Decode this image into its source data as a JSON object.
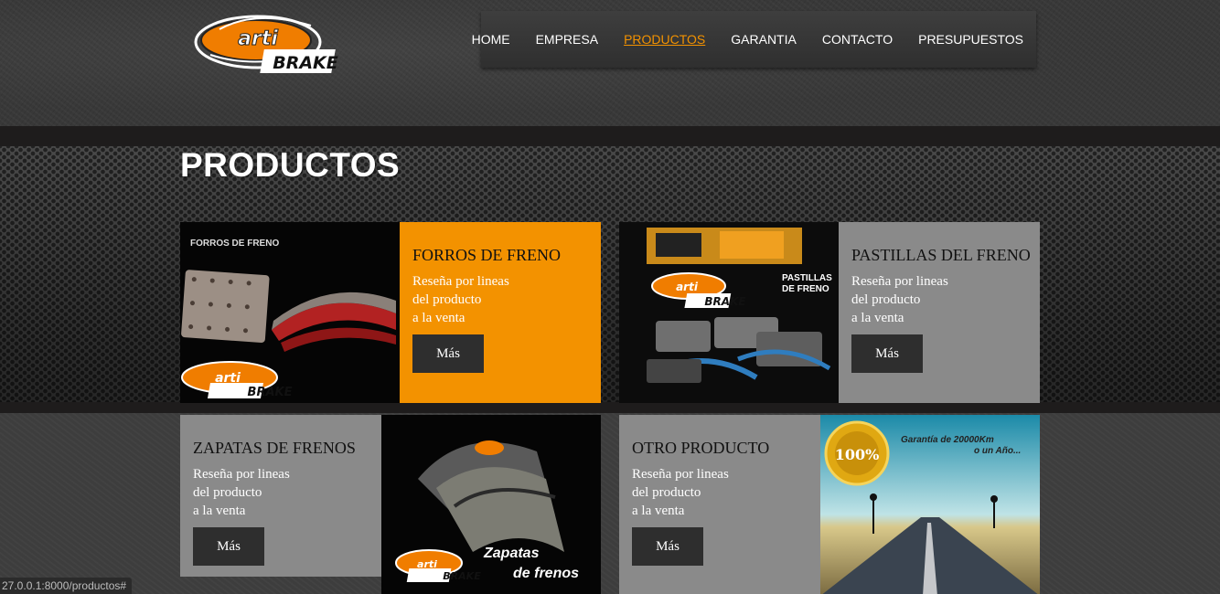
{
  "logo": {
    "word1": "arti",
    "word2": "BRAKE"
  },
  "nav": {
    "items": [
      {
        "label": "HOME"
      },
      {
        "label": "EMPRESA"
      },
      {
        "label": "PRODUCTOS"
      },
      {
        "label": "GARANTIA"
      },
      {
        "label": "CONTACTO"
      },
      {
        "label": "PRESUPUESTOS"
      }
    ],
    "active_index": 2,
    "active_color": "#f39200"
  },
  "page_title": "PRODUCTOS",
  "products": [
    {
      "title": "FORROS DE FRENO",
      "description": "Reseña por lineas\ndel producto\na la venta",
      "button": "Más",
      "panel_color": "#f39200",
      "image_caption": "FORROS DE FRENO"
    },
    {
      "title": "PASTILLAS DEL FRENO",
      "description": "Reseña por lineas\ndel producto\na la venta",
      "button": "Más",
      "panel_color": "#8a8a8a",
      "image_caption": "PASTILLAS\nDE FRENO"
    },
    {
      "title": "ZAPATAS DE FRENOS",
      "description": "Reseña por lineas\ndel producto\na la venta",
      "button": "Más",
      "panel_color": "#8a8a8a",
      "image_caption": "Zapatas\nde frenos"
    },
    {
      "title": "OTRO PRODUCTO",
      "description": "Reseña por lineas\ndel producto\na la venta",
      "button": "Más",
      "panel_color": "#8a8a8a",
      "image_caption": "Garantía de 20000Km\no un Año...",
      "badge": "100%"
    }
  ],
  "status_bar": "27.0.0.1:8000/productos#"
}
